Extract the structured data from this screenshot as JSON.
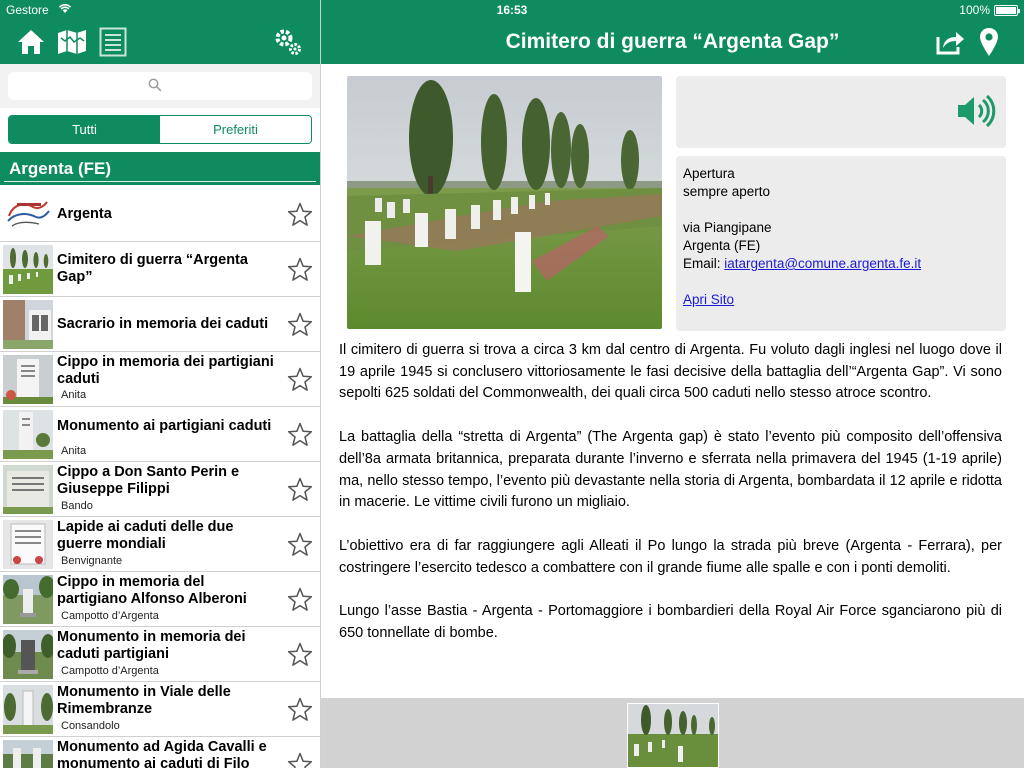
{
  "status_bar": {
    "carrier": "Gestore",
    "time": "16:53",
    "battery": "100%"
  },
  "left_nav": {
    "icons": [
      "home-icon",
      "map-icon",
      "list-icon",
      "settings-icon"
    ]
  },
  "right_nav": {
    "title": "Cimitero di guerra “Argenta Gap”",
    "icons": [
      "share-icon",
      "location-pin-icon"
    ]
  },
  "search": {
    "placeholder": "",
    "value": ""
  },
  "segments": {
    "all": "Tutti",
    "favorites": "Preferiti",
    "selected": "Tutti"
  },
  "section": {
    "title": "Argenta (FE)"
  },
  "list": [
    {
      "title": "Argenta",
      "subtitle": ""
    },
    {
      "title": "Cimitero di guerra “Argenta Gap”",
      "subtitle": ""
    },
    {
      "title": "Sacrario in memoria dei caduti",
      "subtitle": ""
    },
    {
      "title": "Cippo in memoria dei partigiani caduti",
      "subtitle": "Anita"
    },
    {
      "title": "Monumento ai partigiani caduti",
      "subtitle": "Anita"
    },
    {
      "title": "Cippo a Don Santo Perin e Giuseppe Filippi",
      "subtitle": "Bando"
    },
    {
      "title": "Lapide ai caduti delle due guerre mondiali",
      "subtitle": "Benvignante"
    },
    {
      "title": "Cippo in memoria del partigiano Alfonso Alberoni",
      "subtitle": "Campotto d’Argenta"
    },
    {
      "title": "Monumento in memoria dei caduti partigiani",
      "subtitle": "Campotto d’Argenta"
    },
    {
      "title": "Monumento in Viale delle Rimembranze",
      "subtitle": "Consandolo"
    },
    {
      "title": "Monumento ad Agida Cavalli e monumento ai caduti di Filo",
      "subtitle": ""
    }
  ],
  "info": {
    "opening_label": "Apertura",
    "opening_value": "sempre aperto",
    "address": "via Piangipane",
    "city": "Argenta (FE)",
    "email_label": "Email:",
    "email": "iatargenta@comune.argenta.fe.it",
    "site_link": "Apri Sito"
  },
  "description": [
    "Il cimitero di guerra si trova a circa 3 km dal centro di Argenta. Fu voluto dagli inglesi nel luogo dove il 19 aprile 1945 si conclusero vittoriosamente le fasi decisive della battaglia dell’“Argenta Gap”. Vi sono sepolti 625 soldati del Commonwealth, dei quali circa 500 caduti nello stesso atroce scontro.",
    "La battaglia della “stretta di Argenta” (The Argenta gap) è stato l’evento più composito dell’offensiva dell’8a armata britannica, preparata durante l’inverno e sferrata nella primavera del 1945 (1-19 aprile) ma, nello stesso tempo, l’evento più devastante nella storia di Argenta, bombardata il 12 aprile e ridotta in macerie. Le vittime civili furono un migliaio.",
    "L’obiettivo era di far raggiungere agli Alleati il Po lungo la strada più breve (Argenta - Ferrara), per costringere l’esercito tedesco a combattere con il grande fiume alle spalle e con i ponti demoliti.",
    "Lungo l’asse Bastia - Argenta - Portomaggiore i bombardieri della Royal Air Force sganciarono più di 650 tonnellate di bombe."
  ],
  "colors": {
    "brand_green": "#0e8c5f",
    "panel_gray": "#ececec",
    "link_blue": "#1a1ad6"
  }
}
